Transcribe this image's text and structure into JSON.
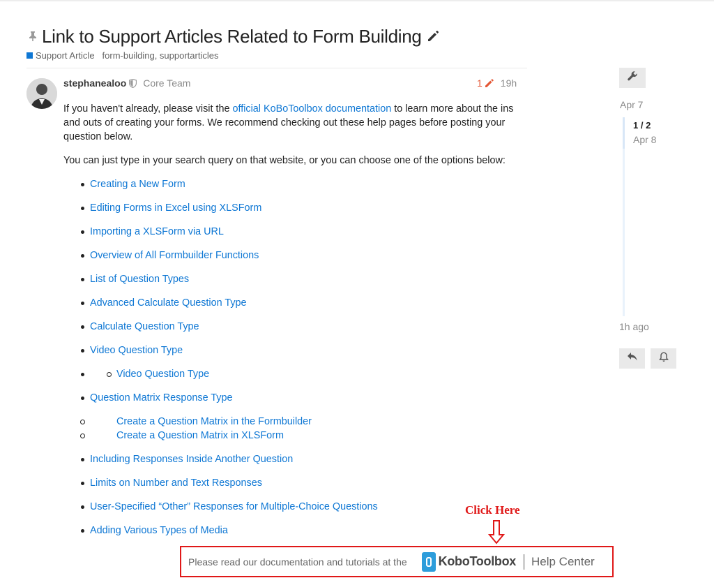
{
  "topic": {
    "title": "Link to Support Articles Related to Form Building",
    "category": "Support Article",
    "tags": "form-building, supportarticles",
    "colors": {
      "category": "#0e77d4",
      "link": "#0e77d4",
      "edit_count": "#e45735"
    }
  },
  "post": {
    "username": "stephanealoo",
    "role": "Core Team",
    "edit_count": "1",
    "age": "19h",
    "intro_before_link": "If you haven't already, please visit the ",
    "intro_link": "official KoBoToolbox documentation",
    "intro_after_link": " to learn more about the ins and outs of creating your forms. We recommend checking out these help pages before posting your question below.",
    "second_paragraph": "You can just type in your search query on that website, or you can choose one of the options below:",
    "links": [
      "Creating a New Form",
      "Editing Forms in Excel using XLSForm",
      "Importing a XLSForm via URL",
      "Overview of All Formbuilder Functions",
      "List of Question Types",
      "Advanced Calculate Question Type",
      "Calculate Question Type",
      "Video Question Type"
    ],
    "nested_video_link": "Video Question Type",
    "matrix_link": "Question Matrix Response Type",
    "matrix_sub_links": [
      "Create a Question Matrix in the Formbuilder",
      "Create a Question Matrix in XLSForm"
    ],
    "more_links": [
      "Including Responses Inside Another Question",
      "Limits on Number and Text Responses",
      "User-Specified “Other” Responses for Multiple-Choice Questions",
      "Adding Various Types of Media"
    ]
  },
  "timeline": {
    "start_date": "Apr 7",
    "position": "1 / 2",
    "current_date": "Apr 8",
    "end_label": "1h ago"
  },
  "annotation": {
    "label": "Click Here",
    "color": "#e01818"
  },
  "banner": {
    "text": "Please read our documentation and tutorials at the",
    "brand": "KoboToolbox",
    "help_center": "Help Center",
    "brand_color": "#2d9ddb"
  }
}
